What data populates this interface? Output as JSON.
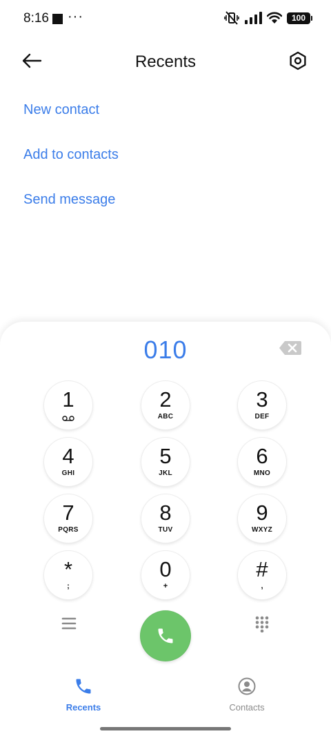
{
  "status_bar": {
    "time": "8:16",
    "battery": "100"
  },
  "header": {
    "title": "Recents"
  },
  "actions": [
    {
      "label": "New contact"
    },
    {
      "label": "Add to contacts"
    },
    {
      "label": "Send message"
    }
  ],
  "dialer": {
    "number": "010",
    "keys": [
      {
        "digit": "1",
        "letters": ""
      },
      {
        "digit": "2",
        "letters": "ABC"
      },
      {
        "digit": "3",
        "letters": "DEF"
      },
      {
        "digit": "4",
        "letters": "GHI"
      },
      {
        "digit": "5",
        "letters": "JKL"
      },
      {
        "digit": "6",
        "letters": "MNO"
      },
      {
        "digit": "7",
        "letters": "PQRS"
      },
      {
        "digit": "8",
        "letters": "TUV"
      },
      {
        "digit": "9",
        "letters": "WXYZ"
      },
      {
        "digit": "*",
        "letters": ";"
      },
      {
        "digit": "0",
        "letters": "+"
      },
      {
        "digit": "#",
        "letters": ","
      }
    ]
  },
  "bottom_nav": {
    "recents_label": "Recents",
    "contacts_label": "Contacts"
  },
  "colors": {
    "accent": "#3b7de9",
    "call_green": "#6cc56a",
    "inactive": "#8a8a8a"
  },
  "icons": {
    "back": "arrow-left-icon",
    "settings": "hexagon-gear-icon",
    "backspace": "backspace-icon",
    "voicemail": "voicemail-icon",
    "menu": "menu-lines-icon",
    "call": "phone-icon",
    "dialpad": "dialpad-grid-icon",
    "recents": "phone-icon",
    "contacts": "person-circle-icon"
  }
}
